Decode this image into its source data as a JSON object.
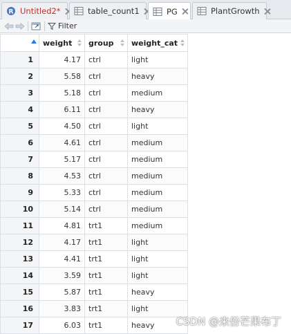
{
  "tabs": [
    {
      "label": "Untitled2*",
      "icon": "r-script-icon",
      "unsaved": true
    },
    {
      "label": "table_count1",
      "icon": "table-icon"
    },
    {
      "label": "PG",
      "icon": "table-icon",
      "active": true
    },
    {
      "label": "PlantGrowth",
      "icon": "table-icon"
    }
  ],
  "toolbar": {
    "filter_label": "Filter"
  },
  "table": {
    "columns": [
      "",
      "weight",
      "group",
      "weight_cat"
    ],
    "rows": [
      [
        "1",
        "4.17",
        "ctrl",
        "light"
      ],
      [
        "2",
        "5.58",
        "ctrl",
        "heavy"
      ],
      [
        "3",
        "5.18",
        "ctrl",
        "medium"
      ],
      [
        "4",
        "6.11",
        "ctrl",
        "heavy"
      ],
      [
        "5",
        "4.50",
        "ctrl",
        "light"
      ],
      [
        "6",
        "4.61",
        "ctrl",
        "medium"
      ],
      [
        "7",
        "5.17",
        "ctrl",
        "medium"
      ],
      [
        "8",
        "4.53",
        "ctrl",
        "medium"
      ],
      [
        "9",
        "5.33",
        "ctrl",
        "medium"
      ],
      [
        "10",
        "5.14",
        "ctrl",
        "medium"
      ],
      [
        "11",
        "4.81",
        "trt1",
        "medium"
      ],
      [
        "12",
        "4.17",
        "trt1",
        "light"
      ],
      [
        "13",
        "4.41",
        "trt1",
        "light"
      ],
      [
        "14",
        "3.59",
        "trt1",
        "light"
      ],
      [
        "15",
        "5.87",
        "trt1",
        "heavy"
      ],
      [
        "16",
        "3.83",
        "trt1",
        "light"
      ],
      [
        "17",
        "6.03",
        "trt1",
        "heavy"
      ]
    ]
  },
  "watermark": "CSDN @来份芒果布丁",
  "colors": {
    "unsaved_tab": "#c0312a",
    "sort_active": "#2a7bd6"
  }
}
